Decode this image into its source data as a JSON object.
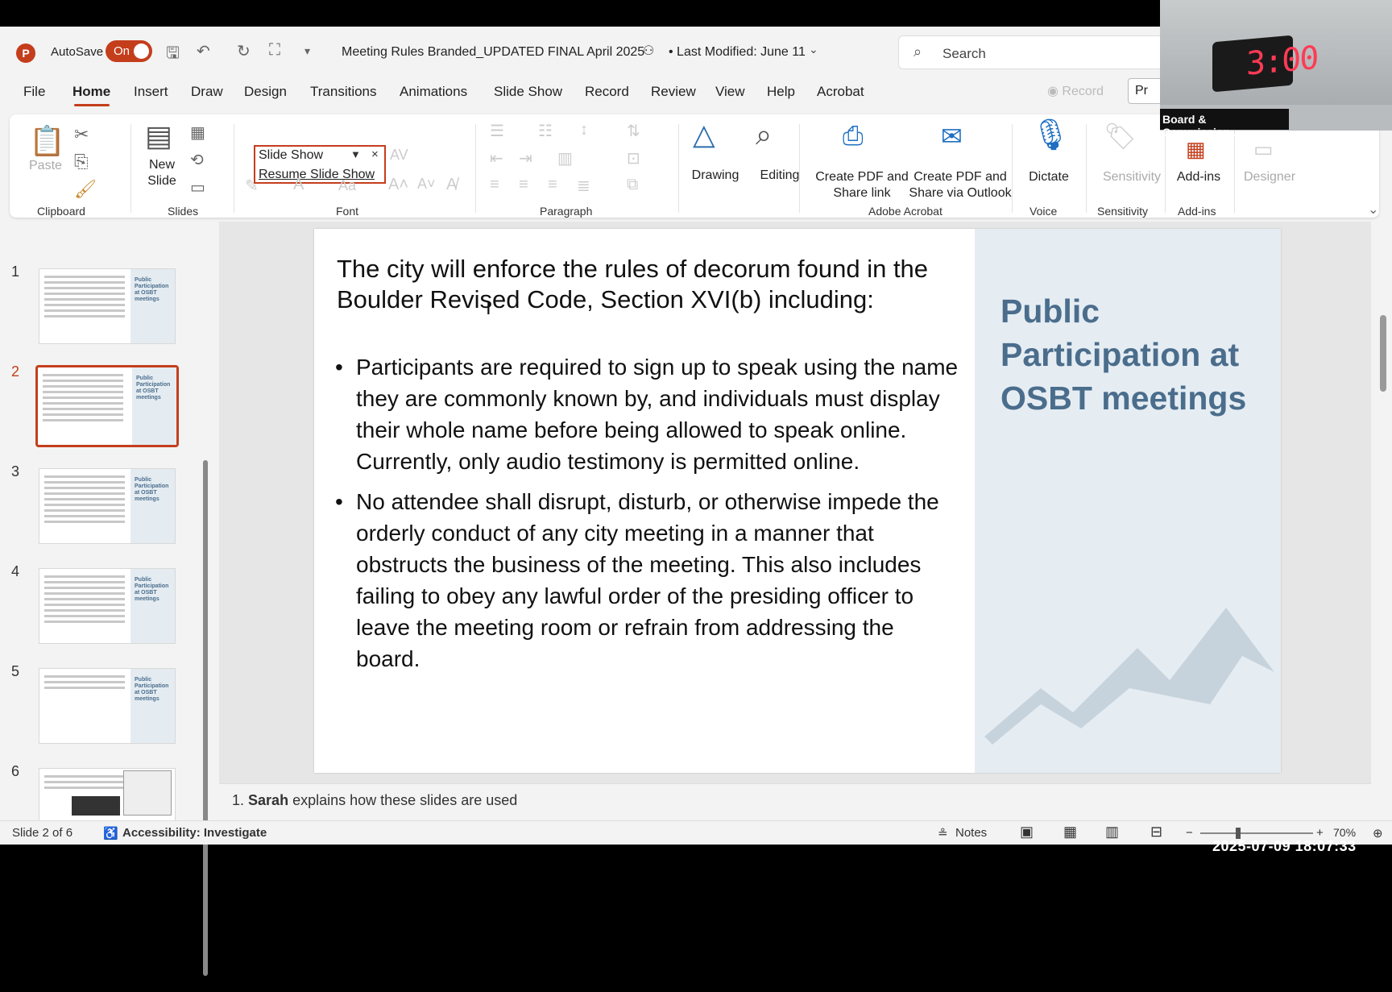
{
  "titlebar": {
    "autosave_label": "AutoSave",
    "autosave_state": "On",
    "document_title": "Meeting Rules Branded_UPDATED FINAL April 2025",
    "last_modified": "• Last Modified: June 11",
    "search_placeholder": "Search"
  },
  "tabs": [
    "File",
    "Home",
    "Insert",
    "Draw",
    "Design",
    "Transitions",
    "Animations",
    "Slide Show",
    "Record",
    "Review",
    "View",
    "Help",
    "Acrobat"
  ],
  "tabs_active": "Home",
  "record_button": "Record",
  "present_button": "Pr",
  "ribbon": {
    "paste": "Paste",
    "new_slide": "New Slide",
    "font_dropdown_item": "Slide Show",
    "resume_slide_show": "Resume Slide Show",
    "drawing": "Drawing",
    "editing": "Editing",
    "create_pdf_share_link": "Create PDF and Share link",
    "create_pdf_share_outlook": "Create PDF and Share via Outlook",
    "dictate": "Dictate",
    "sensitivity": "Sensitivity",
    "add_ins": "Add-ins",
    "designer": "Designer",
    "groups": {
      "clipboard": "Clipboard",
      "slides": "Slides",
      "font": "Font",
      "paragraph": "Paragraph",
      "adobe_acrobat": "Adobe Acrobat",
      "voice": "Voice",
      "sensitivity": "Sensitivity",
      "add_ins": "Add-ins"
    }
  },
  "thumbnails": [
    {
      "num": "1",
      "title": "Public Participation at OSBT meetings"
    },
    {
      "num": "2",
      "title": "Public Participation at OSBT meetings"
    },
    {
      "num": "3",
      "title": "Public Participation at OSBT meetings"
    },
    {
      "num": "4",
      "title": "Public Participation at OSBT meetings"
    },
    {
      "num": "5",
      "title": "Public Participation at OSBT meetings"
    },
    {
      "num": "6",
      "title": ""
    }
  ],
  "active_slide": 2,
  "slide": {
    "intro": "The city will enforce the rules of decorum found in the Boulder Revised Code, Section XVI(b) including:",
    "bullets": [
      "Participants are required to sign up to speak using the name they are commonly known by, and individuals must display their whole name before being allowed to speak online. Currently, only audio testimony is permitted online.",
      "No attendee shall disrupt, disturb, or otherwise impede the orderly conduct of any city meeting in a manner that obstructs the business of the meeting. This also includes failing to obey any lawful order of the presiding officer to leave the meeting room or refrain from addressing the board."
    ],
    "side_heading": "Public Participation at OSBT meetings"
  },
  "notes": {
    "number": "1.",
    "name": "Sarah",
    "text": "explains how these slides are used"
  },
  "status": {
    "slide_counter": "Slide 2 of 6",
    "accessibility": "Accessibility: Investigate",
    "notes_button": "Notes",
    "zoom": "70%"
  },
  "webcam": {
    "clock": "3:00",
    "label": "Board & Commission..."
  },
  "datestamp": "2025-07-09  18:07:33"
}
